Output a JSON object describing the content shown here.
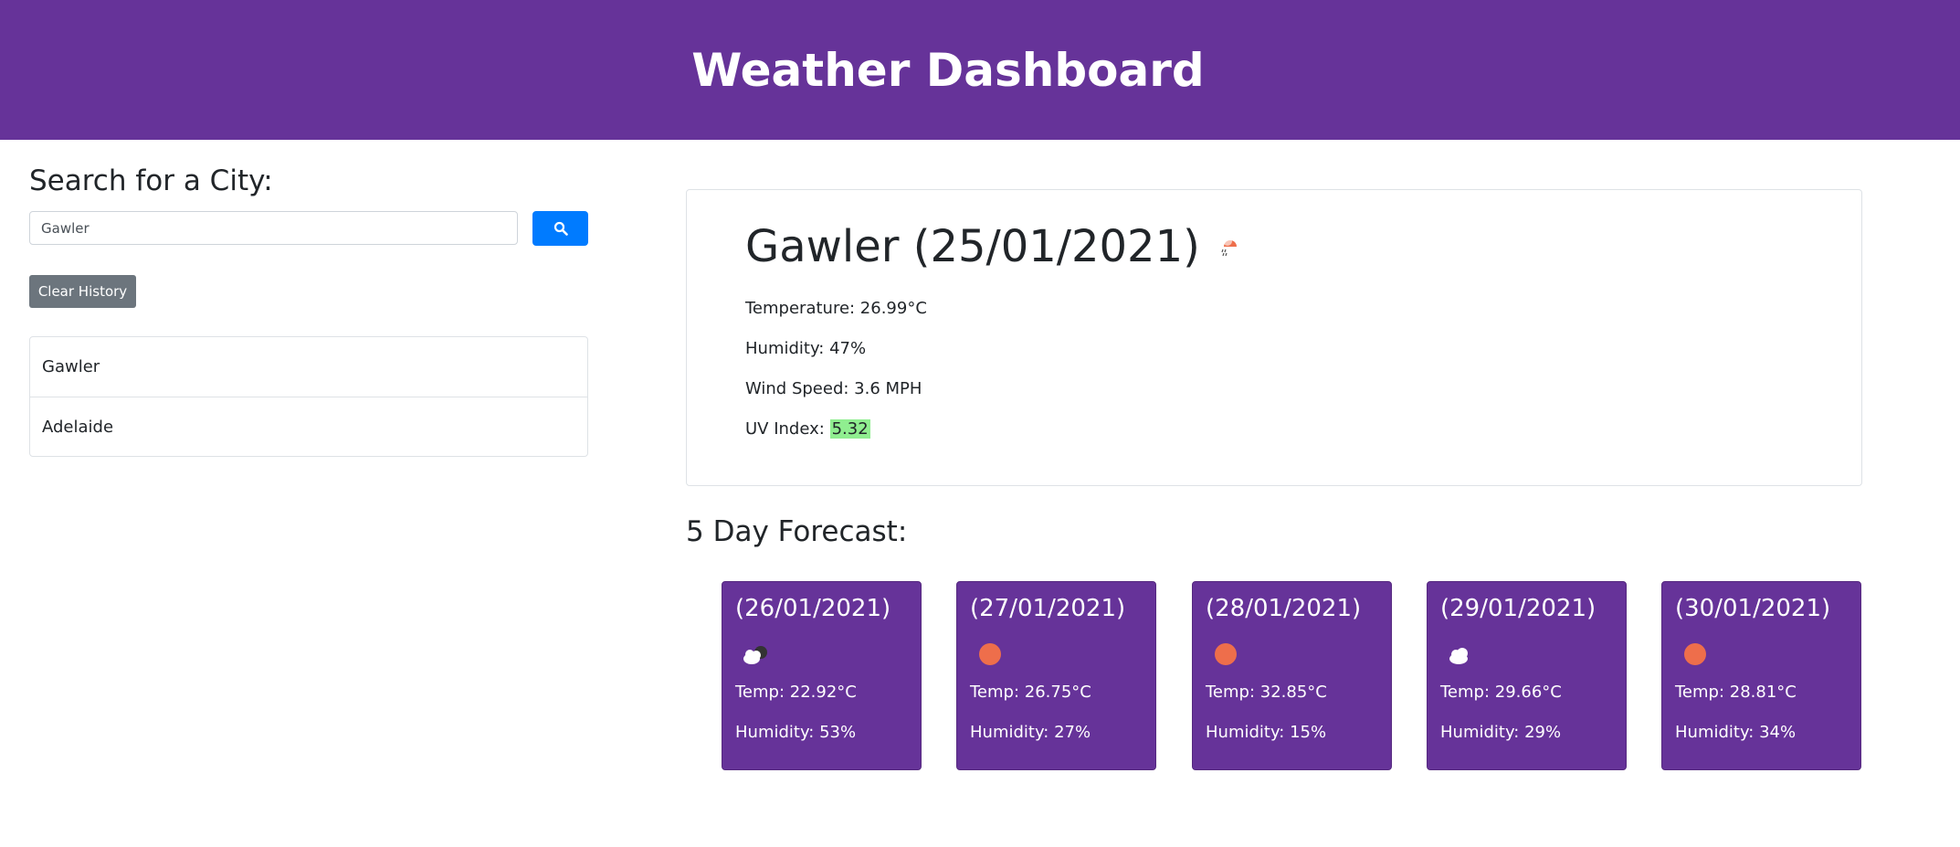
{
  "header": {
    "title": "Weather Dashboard"
  },
  "search": {
    "title": "Search for a City:",
    "value": "Gawler",
    "button_icon": "search-icon",
    "clear_label": "Clear History"
  },
  "history": [
    "Gawler",
    "Adelaide"
  ],
  "current": {
    "title": "Gawler (25/01/2021)",
    "icon": "rain-icon",
    "temperature": "Temperature: 26.99°C",
    "humidity": "Humidity: 47%",
    "wind": "Wind Speed: 3.6 MPH",
    "uv_label": "UV Index: ",
    "uv_value": "5.32"
  },
  "forecast": {
    "title": "5 Day Forecast:",
    "days": [
      {
        "date": "(26/01/2021)",
        "icon": "cloud-night-icon",
        "temp": "Temp: 22.92°C",
        "humidity": "Humidity: 53%"
      },
      {
        "date": "(27/01/2021)",
        "icon": "sun-icon",
        "temp": "Temp: 26.75°C",
        "humidity": "Humidity: 27%"
      },
      {
        "date": "(28/01/2021)",
        "icon": "sun-icon",
        "temp": "Temp: 32.85°C",
        "humidity": "Humidity: 15%"
      },
      {
        "date": "(29/01/2021)",
        "icon": "cloud-icon",
        "temp": "Temp: 29.66°C",
        "humidity": "Humidity: 29%"
      },
      {
        "date": "(30/01/2021)",
        "icon": "sun-icon",
        "temp": "Temp: 28.81°C",
        "humidity": "Humidity: 34%"
      }
    ]
  },
  "colors": {
    "header": "#663399",
    "search_button": "#007bff",
    "clear_button": "#6c757d",
    "uv_highlight": "#90ee90",
    "sun": "#ee6e4b"
  }
}
